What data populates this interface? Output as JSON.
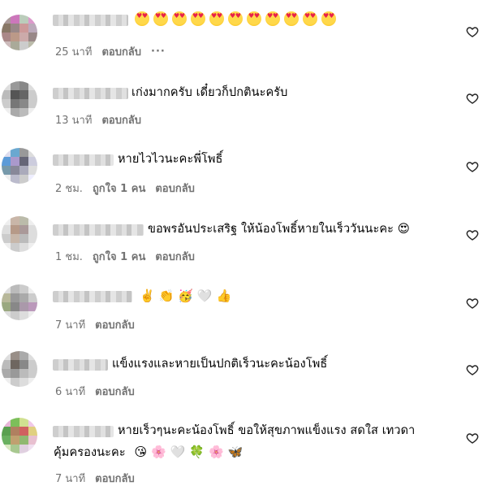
{
  "comments": [
    {
      "text": "",
      "emoji_row": [
        "heart-eyes",
        "heart-eyes",
        "heart-eyes",
        "heart-eyes",
        "heart-eyes",
        "heart-eyes",
        "heart-eyes",
        "heart-eyes",
        "heart-eyes",
        "heart-eyes",
        "heart-eyes"
      ],
      "time": "25 นาที",
      "likes": "",
      "reply": "ตอบกลับ",
      "more": "···"
    },
    {
      "text": "เก่งมากครับ เดี๋ยวก็ปกตินะครับ",
      "time": "13 นาที",
      "likes": "",
      "reply": "ตอบกลับ"
    },
    {
      "text": "หายไวไวนะคะพี่โพธิ์",
      "time": "2 ชม.",
      "likes": "ถูกใจ 1 คน",
      "reply": "ตอบกลับ"
    },
    {
      "text": "ขอพรอันประเสริฐ ให้น้องโพธิ์หายในเร็ววันนะคะ",
      "trailing_emoji": "😍",
      "time": "1 ชม.",
      "likes": "ถูกใจ 1 คน",
      "reply": "ตอบกลับ"
    },
    {
      "text": "",
      "emoji_text": "✌️ 👏 🥳 🤍 👍",
      "time": "7 นาที",
      "likes": "",
      "reply": "ตอบกลับ"
    },
    {
      "text": "แข็งแรงและหายเป็นปกติเร็วนะคะน้องโพธิ์",
      "time": "6 นาที",
      "likes": "",
      "reply": "ตอบกลับ"
    },
    {
      "text": "หายเร็วๆนะคะน้องโพธิ์ ขอให้สุขภาพแข็งแรง สดใส เทวดา",
      "text_line2": "คุ้มครองนะคะ",
      "emoji_text": "😘 🌸 🤍 🍀 🌸 🦋",
      "time": "7 นาที",
      "likes": "",
      "reply": "ตอบกลับ"
    }
  ],
  "icons": {
    "like": "heart-outline-icon",
    "more": "more-dots-icon"
  },
  "colors": {
    "meta": "#737373",
    "text": "#000000",
    "heart": "#262626"
  }
}
